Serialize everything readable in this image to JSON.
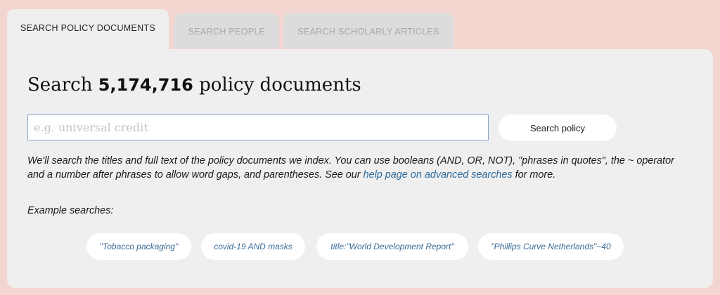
{
  "tabs": [
    {
      "label": "SEARCH POLICY DOCUMENTS"
    },
    {
      "label": "SEARCH PEOPLE"
    },
    {
      "label": "SEARCH SCHOLARLY ARTICLES"
    }
  ],
  "main": {
    "title_prefix": "Search ",
    "title_count": "5,174,716",
    "title_suffix": " policy documents",
    "search_placeholder": "e.g. universal credit",
    "search_button": "Search policy",
    "help_text_1": "We'll search the titles and full text of the policy documents we index. You can use booleans (AND, OR, NOT), \"phrases in quotes\", the ~ operator and a number after phrases to allow word gaps, and parentheses. See our ",
    "help_link": "help page on advanced searches",
    "help_text_2": " for more.",
    "examples_label": "Example searches:",
    "examples": [
      "\"Tobacco packaging\"",
      "covid-19 AND masks",
      "title:\"World Development Report\"",
      "\"Phillips Curve Netherlands\"~40"
    ]
  },
  "colors": {
    "background": "#f2d6cf",
    "panel": "#efefef",
    "link": "#2f6a9a"
  }
}
